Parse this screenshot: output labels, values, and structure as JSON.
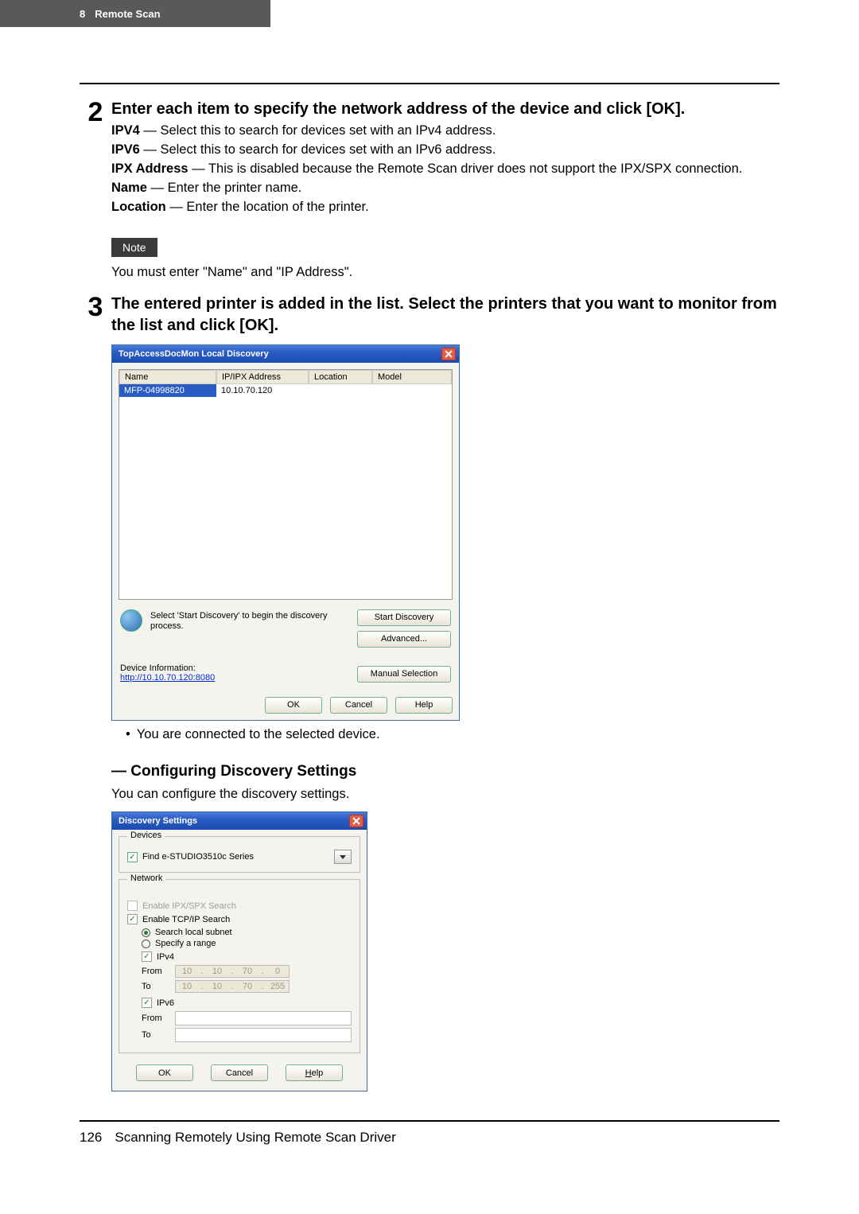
{
  "header": {
    "chapter_num": "8",
    "chapter_title": "Remote Scan"
  },
  "step2": {
    "num": "2",
    "title": "Enter each item to specify the network address of the device and click [OK].",
    "items": {
      "ipv4_label": "IPV4",
      "ipv4_desc": " — Select this to search for devices set with an IPv4 address.",
      "ipv6_label": "IPV6",
      "ipv6_desc": " — Select this to search for devices set with an IPv6 address.",
      "ipx_label": "IPX Address",
      "ipx_desc": " — This is disabled because the Remote Scan driver does not support the IPX/SPX connection.",
      "name_label": "Name",
      "name_desc": " — Enter the printer name.",
      "location_label": "Location",
      "location_desc": " — Enter the location of the printer."
    }
  },
  "note_label": "Note",
  "note_text": "You must enter \"Name\" and \"IP Address\".",
  "step3": {
    "num": "3",
    "title": "The entered printer is added in the list.  Select the printers that you want to monitor from the list and click [OK]."
  },
  "dialog1": {
    "title": "TopAccessDocMon Local Discovery",
    "columns": {
      "name": "Name",
      "ip": "IP/IPX Address",
      "loc": "Location",
      "model": "Model"
    },
    "row": {
      "name": "MFP-04998820",
      "ip": "10.10.70.120"
    },
    "hint": "Select 'Start Discovery' to begin the discovery process.",
    "buttons": {
      "start": "Start Discovery",
      "advanced": "Advanced...",
      "manual": "Manual Selection"
    },
    "devinfo_label": "Device Information:",
    "devinfo_link": "http://10.10.70.120:8080",
    "footer": {
      "ok": "OK",
      "cancel": "Cancel",
      "help": "Help"
    }
  },
  "step3_bullet": "You are connected to the selected device.",
  "section": {
    "heading": "— Configuring Discovery Settings",
    "intro": "You can configure the discovery settings."
  },
  "dialog2": {
    "title": "Discovery Settings",
    "devices_legend": "Devices",
    "devices_value": "Find e-STUDIO3510c Series",
    "network_legend": "Network",
    "ipx_search": "Enable IPX/SPX Search",
    "tcpip_search": "Enable TCP/IP Search",
    "search_local": "Search local subnet",
    "specify_range": "Specify a range",
    "ipv4_label": "IPv4",
    "ipv6_label": "IPv6",
    "from_label": "From",
    "to_label": "To",
    "ipv4_from": {
      "o1": "10",
      "o2": "10",
      "o3": "70",
      "o4": "0"
    },
    "ipv4_to": {
      "o1": "10",
      "o2": "10",
      "o3": "70",
      "o4": "255"
    },
    "footer": {
      "ok": "OK",
      "cancel": "Cancel",
      "help_pre": "H",
      "help_rest": "elp"
    }
  },
  "footer": {
    "page_num": "126",
    "text": "Scanning Remotely Using Remote Scan Driver"
  }
}
